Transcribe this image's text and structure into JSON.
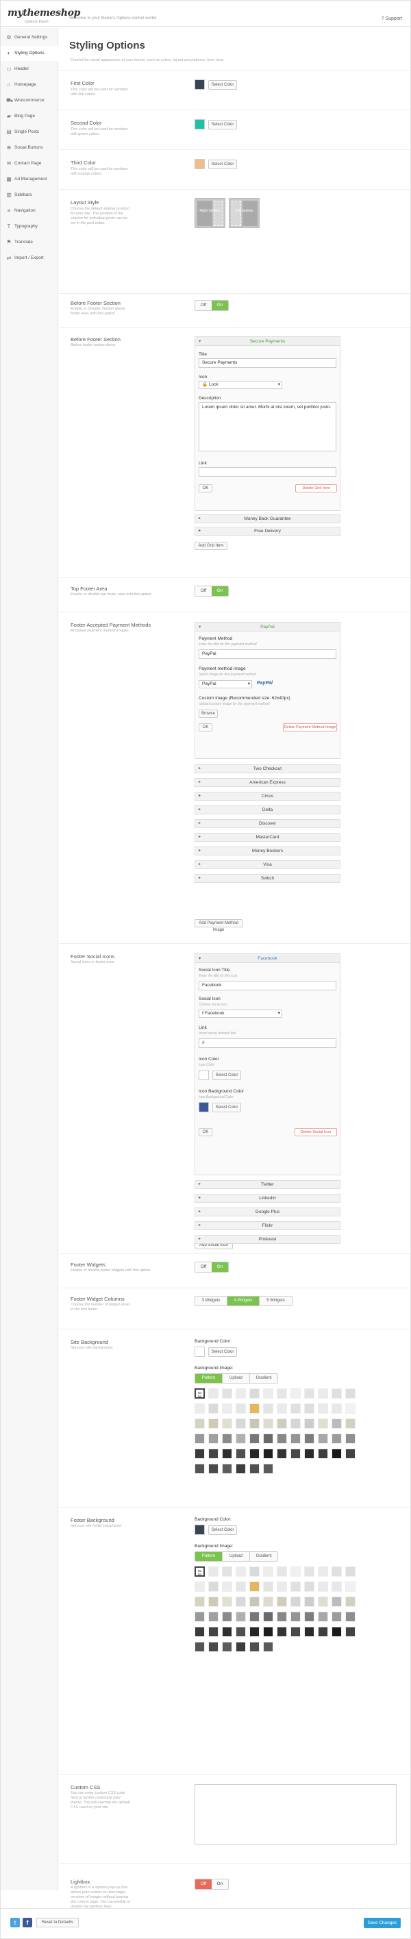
{
  "header": {
    "logo": "mythemeshop",
    "logo_sub": "Options Panel",
    "welcome": "Welcome to your theme's Options control center",
    "support": "Support"
  },
  "sidebar": {
    "items": [
      {
        "label": "General Settings",
        "icon": "cog-icon",
        "glyph": "⚙"
      },
      {
        "label": "Styling Options",
        "icon": "palette-icon",
        "glyph": "◐"
      },
      {
        "label": "Header",
        "icon": "header-icon",
        "glyph": "▭"
      },
      {
        "label": "Homepage",
        "icon": "home-icon",
        "glyph": "⌂"
      },
      {
        "label": "Woocommerce",
        "icon": "cart-icon",
        "glyph": "⛟"
      },
      {
        "label": "Blog Page",
        "icon": "folder-icon",
        "glyph": "▰"
      },
      {
        "label": "Single Posts",
        "icon": "document-icon",
        "glyph": "▤"
      },
      {
        "label": "Social Buttons",
        "icon": "share-icon",
        "glyph": "⊕"
      },
      {
        "label": "Contact Page",
        "icon": "envelope-icon",
        "glyph": "✉"
      },
      {
        "label": "Ad Management",
        "icon": "megaphone-icon",
        "glyph": "▦"
      },
      {
        "label": "Sidebars",
        "icon": "sidebar-icon",
        "glyph": "▥"
      },
      {
        "label": "Navigation",
        "icon": "menu-icon",
        "glyph": "≡"
      },
      {
        "label": "Typography",
        "icon": "typography-icon",
        "glyph": "T"
      },
      {
        "label": "Translate",
        "icon": "translate-icon",
        "glyph": "⚑"
      },
      {
        "label": "Import / Export",
        "icon": "transfer-icon",
        "glyph": "⇄"
      }
    ]
  },
  "page": {
    "title": "Styling Options",
    "desc": "Control the visual appearance of your theme, such as colors, layout and patterns, from here."
  },
  "colors": {
    "first": {
      "label": "First Color",
      "desc": "This color will be used for sections with link colors.",
      "value": "#374554",
      "button": "Select Color"
    },
    "second": {
      "label": "Second Color",
      "desc": "This color will be used for sections with green colors.",
      "value": "#1fc3a3",
      "button": "Select Color"
    },
    "third": {
      "label": "Third Color",
      "desc": "This color will be used for sections with orange colors.",
      "value": "#f1be8b",
      "button": "Select Color"
    }
  },
  "layout": {
    "label": "Layout Style",
    "desc": "Choose the default sidebar position for your site. The position of the sidebar for individual posts can be set in the post editor.",
    "opt1": "Right Sidebar",
    "opt2": "Left Sidebar"
  },
  "before_footer": {
    "label": "Before Footer Section",
    "desc": "Enable or Disable Section above footer area with this option.",
    "off": "Off",
    "on": "On"
  },
  "before_footer_sec": {
    "label": "Before Footer Section",
    "desc": "Before footer section items.",
    "head": "Secure Payments",
    "title_label": "Title",
    "title_value": "Secure Payments",
    "icon_label": "Icon",
    "icon_value": "Lock",
    "desc_label": "Description",
    "desc_value": "Lorem ipsum dolor sit amet. Morbi at nisi lorem, vel porttitor justo.",
    "link_label": "Link",
    "link_value": "",
    "ok": "OK",
    "delete": "Delete Grid Item",
    "collapsed": [
      "Money Back Guarantee",
      "Free Delivery"
    ],
    "add": "Add Grid Item"
  },
  "top_footer": {
    "label": "Top Footer Area",
    "desc": "Enable or disable top footer area with this option.",
    "off": "Off",
    "on": "On"
  },
  "payments": {
    "label": "Footer Accepted Payment Methods",
    "desc": "Accepted payment method images.",
    "head": "PayPal",
    "method_label": "Payment Method",
    "method_desc": "Enter the title for this payment method",
    "method_value": "PayPal",
    "image_label": "Payment method image",
    "image_desc": "Select image for this payment method",
    "image_value": "PayPal",
    "image_logo": "PayPal",
    "custom_label": "Custom image (Recommended size: 62x40px)",
    "custom_desc": "Upload custom image for this payment method",
    "browse": "Browse",
    "ok": "OK",
    "delete": "Delete Payment Method Image",
    "collapsed": [
      "Two Checkout",
      "American Express",
      "Cirrus",
      "Delta",
      "Discover",
      "MasterCard",
      "Money Bookers",
      "Visa",
      "Switch"
    ],
    "add": "Add Payment Method Image"
  },
  "social": {
    "label": "Footer Social Icons",
    "desc": "Social icons in footer area.",
    "head": "Facebook",
    "title_label": "Social Icon Title",
    "title_desc": "Enter the title for this icon",
    "title_value": "Facebook",
    "icon_label": "Social Icon",
    "icon_desc": "Choose social icon",
    "icon_value": "Facebook",
    "link_label": "Link",
    "link_desc": "Insert social network link",
    "link_value": "#",
    "color_label": "Icon Color",
    "color_desc": "Icon Color",
    "color_value": "#ffffff",
    "bg_label": "Icon Background Color",
    "bg_desc": "Icon Background Color",
    "bg_value": "#3b5998",
    "select": "Select Color",
    "ok": "OK",
    "delete": "Delete Social Icon",
    "collapsed": [
      "Twitter",
      "LinkedIn",
      "Google Plus",
      "Flickr",
      "Pinterest"
    ],
    "add": "Add Social Icon"
  },
  "footer_widgets": {
    "label": "Footer Widgets",
    "desc": "Enable or disable footer widgets with this option.",
    "off": "Off",
    "on": "On"
  },
  "widget_cols": {
    "label": "Footer Widget Columns",
    "desc": "Choose the number of widget areas in the first footer.",
    "options": [
      "3 Widgets",
      "4 Widgets",
      "5 Widgets"
    ],
    "selected": 1
  },
  "site_bg": {
    "label": "Site Background",
    "desc": "Set your site background.",
    "color_label": "Background Color:",
    "color_value": "#ffffff",
    "select": "Select Color",
    "image_label": "Background Image:",
    "tabs": [
      "Pattern",
      "Upload",
      "Gradient"
    ],
    "no_bg": "No bg"
  },
  "footer_bg": {
    "label": "Footer Background",
    "desc": "Set your site footer bacground.",
    "color_label": "Background Color:",
    "color_value": "#374554",
    "select": "Select Color",
    "image_label": "Background Image:",
    "tabs": [
      "Pattern",
      "Upload",
      "Gradient"
    ],
    "no_bg": "No bg"
  },
  "custom_css": {
    "label": "Custom CSS",
    "desc": "You can enter custom CSS code here to further customize your theme. This will override the default CSS used on your site.",
    "value": ""
  },
  "lightbox": {
    "label": "Lightbox",
    "desc": "A lightbox is a stylized pop-up that allows your visitors to view larger versions of images without leaving the current page. You can enable or disable the lightbox here.",
    "off": "Off",
    "on": "On"
  },
  "footer": {
    "reset": "Reset to Defaults",
    "save": "Save Changes",
    "twitter_icon": "twitter-icon",
    "facebook_icon": "facebook-icon"
  }
}
